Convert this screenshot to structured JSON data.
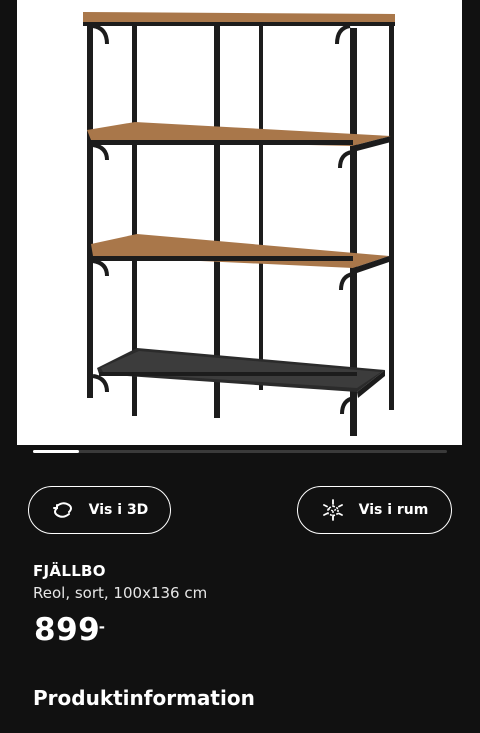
{
  "product_image": {
    "alt": "FJÄLLBO shelf unit"
  },
  "carousel": {
    "progress": 0.11
  },
  "actions": {
    "view_3d_label": "Vis i 3D",
    "view_3d_icon": "rotate-3d-icon",
    "view_room_label": "Vis i rum",
    "view_room_icon": "ar-cube-icon"
  },
  "product": {
    "name": "FJÄLLBO",
    "description": "Reol, sort, 100x136 cm",
    "price": "899",
    "price_suffix": ".-"
  },
  "sections": {
    "product_info": "Produktinformation"
  },
  "colors": {
    "background": "#111111",
    "text": "#ffffff",
    "wood": "#a9774a",
    "frame": "#1c1c1c"
  }
}
